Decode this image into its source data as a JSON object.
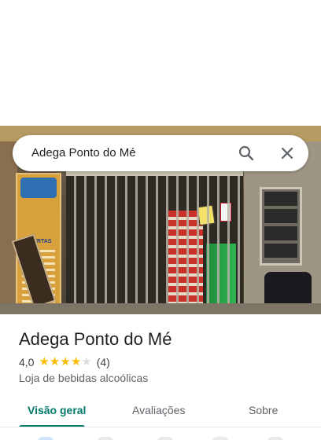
{
  "search": {
    "query": "Adega Ponto do Mé",
    "search_icon": "search-icon",
    "close_icon": "close-icon"
  },
  "photo": {
    "poster_text": "OFERTAS"
  },
  "place": {
    "name": "Adega Ponto do Mé",
    "rating": "4,0",
    "rating_stars": 4,
    "rating_max": 5,
    "review_count": "(4)",
    "category": "Loja de bebidas alcoólicas"
  },
  "tabs": [
    {
      "label": "Visão geral",
      "active": true
    },
    {
      "label": "Avaliações",
      "active": false
    },
    {
      "label": "Sobre",
      "active": false
    }
  ],
  "colors": {
    "accent": "#00796b",
    "star": "#fbbc04",
    "star_empty": "#dadce0"
  }
}
